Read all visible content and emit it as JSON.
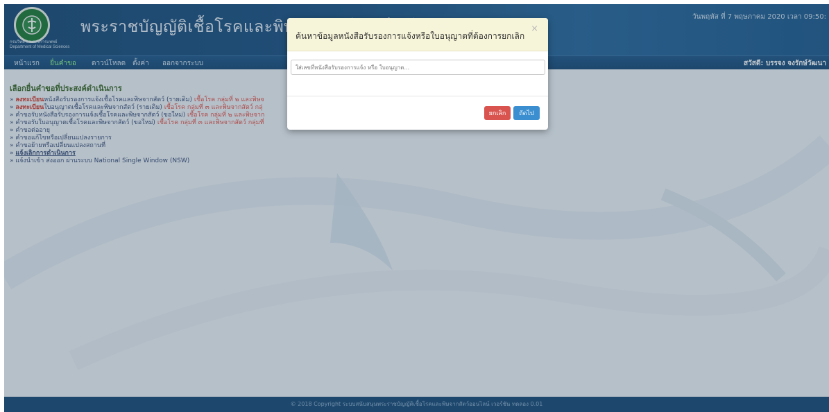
{
  "header": {
    "logo_caption_line1": "กรมวิทยาศาสตร์การแพทย์",
    "logo_caption_line2": "Department of Medical Sciences",
    "title": "พระราชบัญญัติเชื้อโรคและพิษจากสัตว์ออนไลน์",
    "date": "วันพฤหัส ที่ 7 พฤษภาคม 2020 เวลา 09:50:"
  },
  "menu": {
    "items": [
      "หน้าแรก",
      "ยื่นคำขอ",
      "ดาวน์โหลด",
      "ตั้งค่า",
      "ออกจากระบบ"
    ],
    "active_index": 1,
    "greeting": "สวัสดี: บรรจง จงรักษ์วัฒนา"
  },
  "content": {
    "heading": "เลือกยื่นคำขอที่ประสงค์ดำเนินการ",
    "options": [
      {
        "prefix": "» ",
        "red": "ลงทะเบียน",
        "text": "หนังสือรับรองการแจ้งเชื้อโรคและพิษจากสัตว์ (รายเดิม) ",
        "pink": "เชื้อโรค กลุ่มที่ ๒ และพิษจ"
      },
      {
        "prefix": "» ",
        "red": "ลงทะเบียน",
        "text": "ใบอนุญาตเชื้อโรคและพิษจากสัตว์ (รายเดิม) ",
        "pink": "เชื้อโรค กลุ่มที่ ๓ และพิษจากสัตว์ กลุ่"
      },
      {
        "prefix": "» ",
        "red": "",
        "text": "คำขอรับหนังสือรับรองการแจ้งเชื้อโรคและพิษจากสัตว์ (ขอใหม่) ",
        "pink": "เชื้อโรค กลุ่มที่ ๒ และพิษจาก"
      },
      {
        "prefix": "» ",
        "red": "",
        "text": "คำขอรับใบอนุญาตเชื้อโรคและพิษจากสัตว์ (ขอใหม่) ",
        "pink": "เชื้อโรค กลุ่มที่ ๓ และพิษจากสัตว์ กลุ่มที่"
      },
      {
        "prefix": "» ",
        "red": "",
        "text": "คำขอต่ออายุ",
        "pink": ""
      },
      {
        "prefix": "» ",
        "red": "",
        "text": "คำขอแก้ไขหรือเปลี่ยนแปลงรายการ",
        "pink": ""
      },
      {
        "prefix": "» ",
        "red": "",
        "text": "คำขอย้ายหรือเปลี่ยนแปลงสถานที่",
        "pink": ""
      },
      {
        "prefix": "» ",
        "red": "",
        "text": "แจ้งเลิกการดำเนินการ",
        "pink": "",
        "underline": true
      },
      {
        "prefix": "» ",
        "red": "",
        "text": "แจ้งนำเข้า ส่งออก ผ่านระบบ National Single Window (NSW)",
        "pink": ""
      }
    ]
  },
  "footer": {
    "text": "© 2018 Copyright ระบบสนับสนุนพระราชบัญญัติเชื้อโรคและพิษจากสัตว์ออนไลน์ เวอร์ชัน ทดลอง 0.01"
  },
  "modal": {
    "title": "ค้นหาข้อมูลหนังสือรับรองการแจ้งหรือใบอนุญาตที่ต้องการยกเลิก",
    "close_glyph": "×",
    "input_placeholder": "ใส่เลขที่หนังสือรับรองการแจ้ง หรือ ใบอนุญาต...",
    "input_value": "",
    "cancel_label": "ยกเลิก",
    "next_label": "ถัดไป"
  },
  "colors": {
    "header_bg": "#1e5586",
    "active_menu": "#8ff08a",
    "modal_header_bg": "#f7f5d9",
    "cancel_button": "#d9534f",
    "next_button": "#3b8fd0"
  },
  "icons": {
    "logo": "department-logo-icon",
    "close": "close-icon"
  }
}
